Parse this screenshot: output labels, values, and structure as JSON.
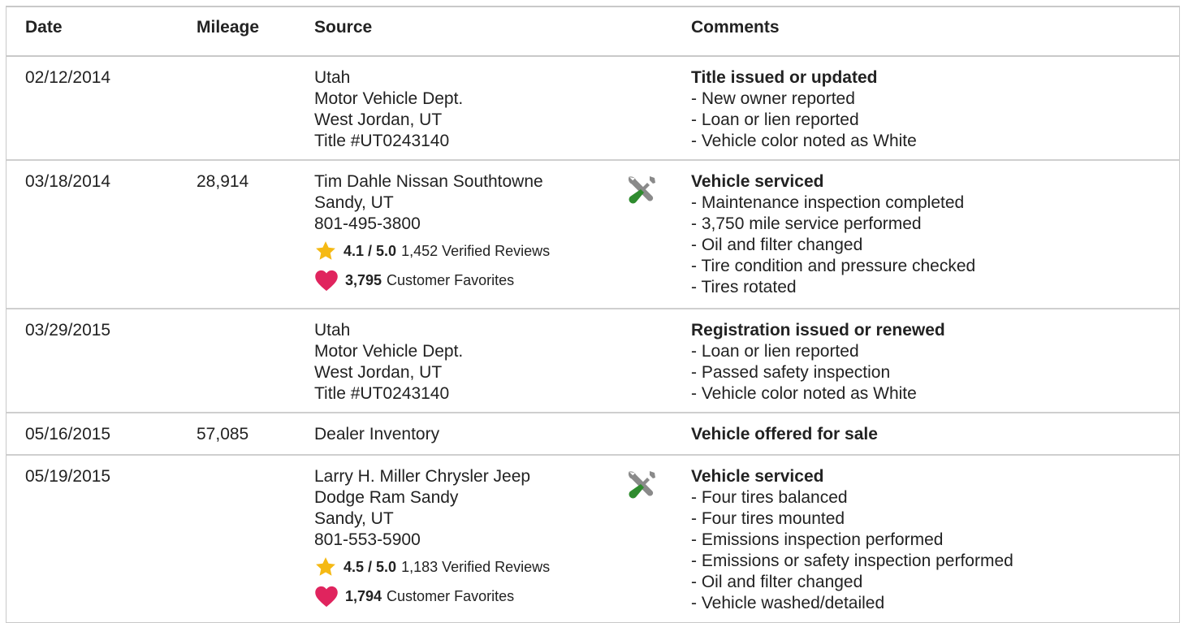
{
  "table": {
    "headers": {
      "date": "Date",
      "mileage": "Mileage",
      "source": "Source",
      "comments": "Comments"
    },
    "rows": [
      {
        "date": "02/12/2014",
        "mileage": "",
        "source_lines": [
          "Utah",
          "Motor Vehicle Dept.",
          "West Jordan, UT",
          "Title #UT0243140"
        ],
        "comment_title": "Title issued or updated",
        "comment_lines": [
          "- New owner reported",
          "- Loan or lien reported",
          "- Vehicle color noted as White"
        ]
      },
      {
        "date": "03/18/2014",
        "mileage": "28,914",
        "source_lines": [
          "Tim Dahle Nissan Southtowne",
          "Sandy, UT",
          "801-495-3800"
        ],
        "rating_score": "4.1 / 5.0",
        "rating_reviews": "1,452 Verified Reviews",
        "favorites_count": "3,795",
        "favorites_label": "Customer Favorites",
        "comment_title": "Vehicle serviced",
        "comment_lines": [
          "- Maintenance inspection completed",
          "- 3,750 mile service performed",
          "- Oil and filter changed",
          "- Tire condition and pressure checked",
          "- Tires rotated"
        ],
        "icon": "service-tools-icon"
      },
      {
        "date": "03/29/2015",
        "mileage": "",
        "source_lines": [
          "Utah",
          "Motor Vehicle Dept.",
          "West Jordan, UT",
          "Title #UT0243140"
        ],
        "comment_title": "Registration issued or renewed",
        "comment_lines": [
          "- Loan or lien reported",
          "- Passed safety inspection",
          "- Vehicle color noted as White"
        ]
      },
      {
        "date": "05/16/2015",
        "mileage": "57,085",
        "source_lines": [
          "Dealer Inventory"
        ],
        "comment_title": "Vehicle offered for sale",
        "comment_lines": []
      },
      {
        "date": "05/19/2015",
        "mileage": "",
        "source_lines": [
          "Larry H. Miller Chrysler Jeep",
          "Dodge Ram Sandy",
          "Sandy, UT",
          "801-553-5900"
        ],
        "rating_score": "4.5 / 5.0",
        "rating_reviews": "1,183 Verified Reviews",
        "favorites_count": "1,794",
        "favorites_label": "Customer Favorites",
        "comment_title": "Vehicle serviced",
        "comment_lines": [
          "- Four tires balanced",
          "- Four tires mounted",
          "- Emissions inspection performed",
          "- Emissions or safety inspection performed",
          "- Oil and filter changed",
          "- Vehicle washed/detailed"
        ],
        "icon": "service-tools-icon"
      }
    ]
  },
  "colors": {
    "star": "#f5b914",
    "heart": "#e0245e",
    "wrench_gray": "#8a8a8a",
    "screwdriver_green": "#2e8b2e",
    "border": "#c9c9c9"
  }
}
